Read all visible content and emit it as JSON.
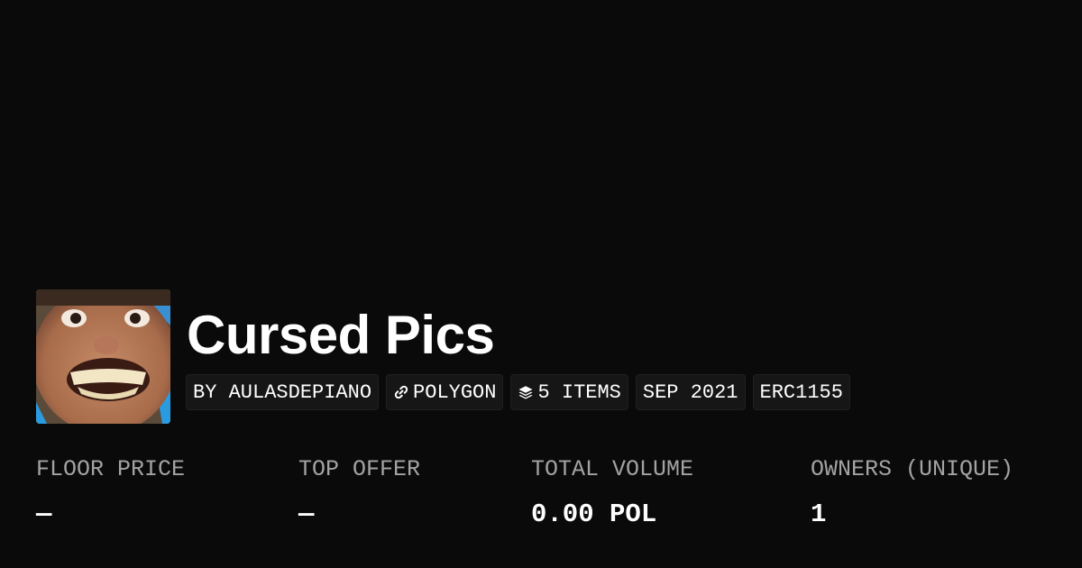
{
  "collection": {
    "title": "Cursed Pics",
    "avatar_alt": "collection-avatar-image"
  },
  "tags": {
    "creator": "BY AULASDEPIANO",
    "chain": {
      "label": "POLYGON",
      "icon": "link-icon"
    },
    "items": {
      "label": "5 ITEMS",
      "icon": "layers-icon"
    },
    "date": "SEP 2021",
    "standard": "ERC1155"
  },
  "stats": {
    "floor_price": {
      "label": "FLOOR PRICE",
      "value": "—"
    },
    "top_offer": {
      "label": "TOP OFFER",
      "value": "—"
    },
    "total_volume": {
      "label": "TOTAL VOLUME",
      "value": "0.00 POL"
    },
    "owners": {
      "label": "OWNERS (UNIQUE)",
      "value": "1"
    }
  },
  "colors": {
    "background": "#0a0a0a",
    "tag_background": "#161616",
    "label": "#a3a3a3",
    "text": "#ffffff"
  }
}
